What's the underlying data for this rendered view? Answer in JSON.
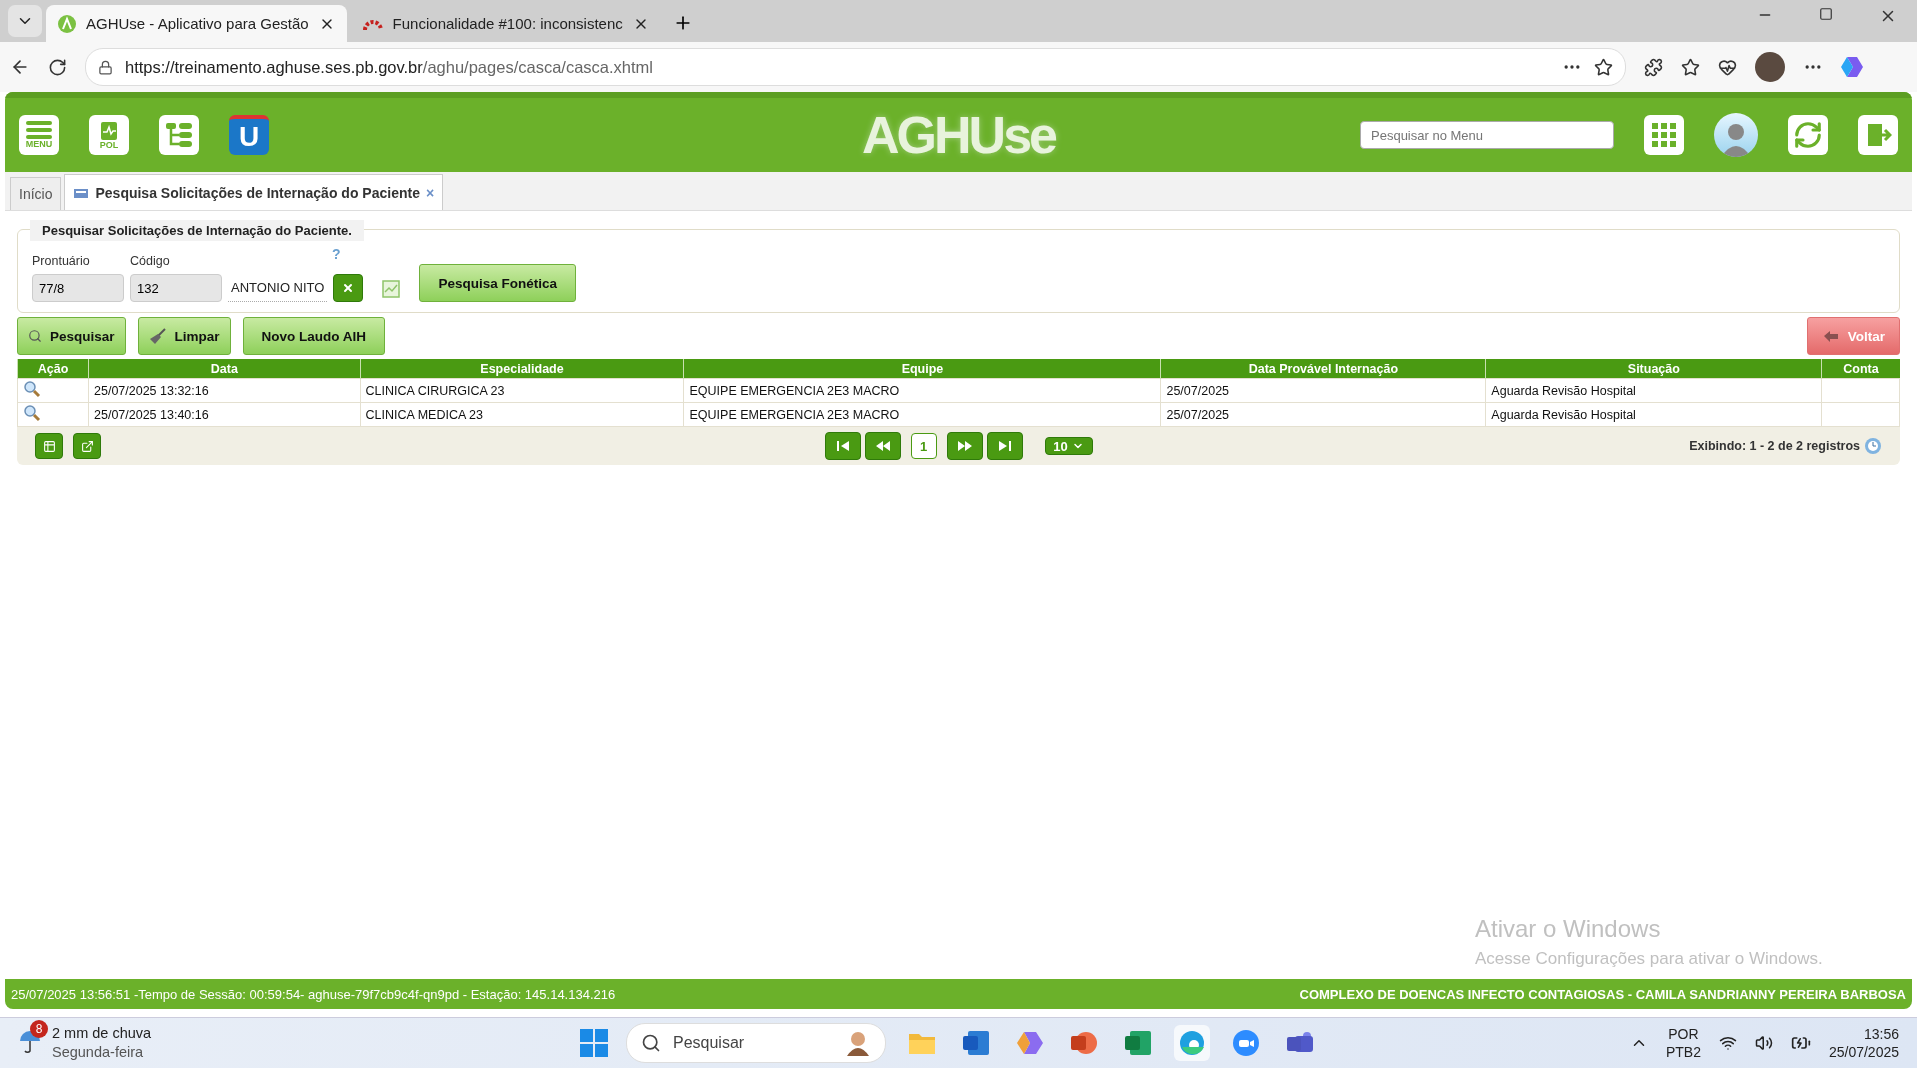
{
  "browser": {
    "tabs": [
      {
        "title": "AGHUse - Aplicativo para Gestão",
        "selected": true
      },
      {
        "title": "Funcionalidade #100: inconsistenc",
        "selected": false
      }
    ],
    "url_host": "https://treinamento.aghuse.ses.pb.gov.br",
    "url_path": "/aghu/pages/casca/casca.xhtml"
  },
  "header": {
    "icons": [
      {
        "kind": "menu",
        "label": "MENU"
      },
      {
        "kind": "pol",
        "label": "POL"
      },
      {
        "kind": "tree"
      },
      {
        "kind": "u",
        "label": "U"
      }
    ],
    "logo": "AGHUse",
    "search": {
      "placeholder": "Pesquisar no Menu"
    }
  },
  "app_tabs": [
    {
      "label": "Início",
      "selected": false,
      "closable": false
    },
    {
      "label": "Pesquisa Solicitações de Internação do Paciente",
      "selected": true,
      "closable": true,
      "close": "×"
    }
  ],
  "form": {
    "legend": "Pesquisar Solicitações de Internação do Paciente.",
    "help": "?",
    "fields": [
      {
        "label": "Prontuário",
        "value": "77/8"
      },
      {
        "label": "Código",
        "value": "132"
      }
    ],
    "patient_name": "ANTONIO NITO",
    "phonetic_button": "Pesquisa Fonética"
  },
  "actions": [
    {
      "kind": "search",
      "label": "Pesquisar"
    },
    {
      "kind": "broom",
      "label": "Limpar"
    },
    {
      "kind": "plain",
      "label": "Novo Laudo AIH"
    }
  ],
  "back_button": "Voltar",
  "table": {
    "columns": [
      "Ação",
      "Data",
      "Especialidade",
      "Equipe",
      "Data Provável Internação",
      "Situação",
      "Conta"
    ],
    "rows": [
      [
        "",
        "25/07/2025 13:32:16",
        "CLINICA CIRURGICA 23",
        "EQUIPE EMERGENCIA 2E3 MACRO",
        "25/07/2025",
        "Aguarda Revisão Hospital",
        ""
      ],
      [
        "",
        "25/07/2025 13:40:16",
        "CLINICA MEDICA 23",
        "EQUIPE EMERGENCIA 2E3 MACRO",
        "25/07/2025",
        "Aguarda Revisão Hospital",
        ""
      ]
    ]
  },
  "pager": {
    "page": "1",
    "page_size": "10",
    "summary": "Exibindo: 1 - 2 de 2 registros"
  },
  "watermark": {
    "title": "Ativar o Windows",
    "subtitle": "Acesse Configurações para ativar o Windows."
  },
  "status_bar": {
    "left": "25/07/2025 13:56:51 -Tempo de Sessão: 00:59:54- aghuse-79f7cb9c4f-qn9pd - Estação: 145.14.134.216",
    "right": "COMPLEXO DE DOENCAS INFECTO CONTAGIOSAS - CAMILA SANDRIANNY PEREIRA BARBOSA"
  },
  "taskbar": {
    "weather_badge": "8",
    "weather": "2 mm de chuva",
    "weekday": "Segunda-feira",
    "search": "Pesquisar",
    "lang": "POR",
    "layout": "PTB2",
    "time": "13:56",
    "date": "25/07/2025"
  }
}
